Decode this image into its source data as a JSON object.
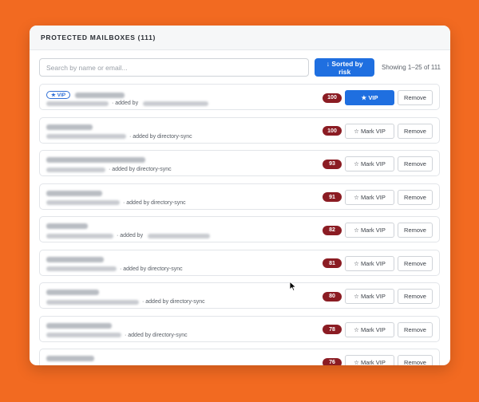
{
  "header": {
    "title": "PROTECTED MAILBOXES (111)"
  },
  "search": {
    "placeholder": "Search by name or email..."
  },
  "sort_button": {
    "label": "↓ Sorted by risk"
  },
  "pagination": {
    "showing": "Showing 1–25 of 111"
  },
  "labels": {
    "vip_badge": "★ VIP",
    "vip_active": "★ VIP",
    "mark_vip": "☆ Mark VIP",
    "remove": "Remove"
  },
  "colors": {
    "accent": "#1f6fe0",
    "score": "#8b1c23",
    "background": "#f26a21"
  },
  "rows": [
    {
      "score": "100",
      "vip": true,
      "meta": "· added by",
      "meta_after_blur": true
    },
    {
      "score": "100",
      "vip": false,
      "meta": "· added by directory-sync"
    },
    {
      "score": "93",
      "vip": false,
      "meta": "· added by directory-sync"
    },
    {
      "score": "91",
      "vip": false,
      "meta": "· added by directory-sync"
    },
    {
      "score": "82",
      "vip": false,
      "meta": "· added by",
      "meta_after_blur": true
    },
    {
      "score": "81",
      "vip": false,
      "meta": "· added by directory-sync"
    },
    {
      "score": "80",
      "vip": false,
      "meta": "· added by directory-sync"
    },
    {
      "score": "78",
      "vip": false,
      "meta": "· added by directory-sync"
    },
    {
      "score": "76",
      "vip": false,
      "meta": ""
    }
  ]
}
